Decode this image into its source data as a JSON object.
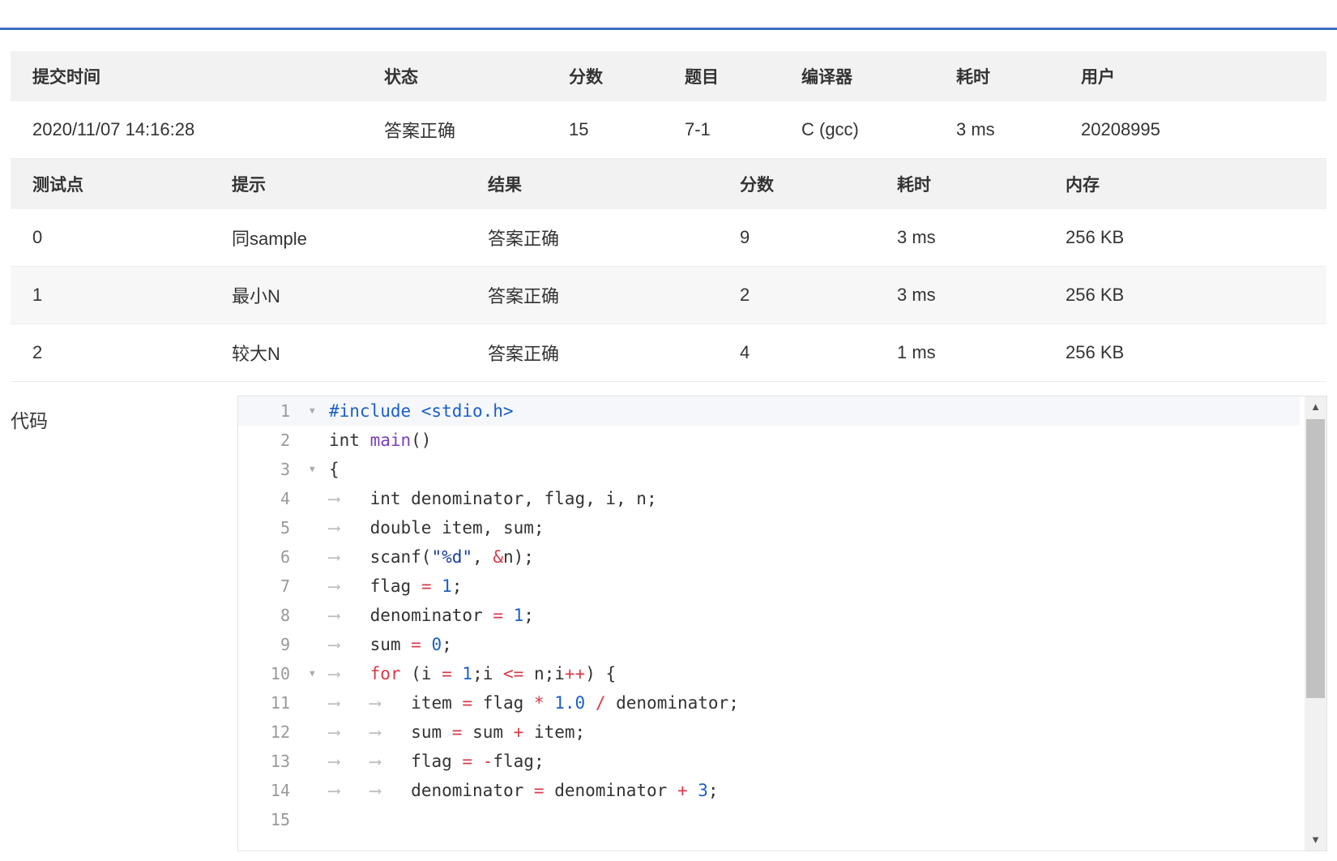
{
  "submission": {
    "headers": [
      "提交时间",
      "状态",
      "分数",
      "题目",
      "编译器",
      "耗时",
      "用户"
    ],
    "row": {
      "time": "2020/11/07 14:16:28",
      "status": "答案正确",
      "score": "15",
      "problem": "7-1",
      "compiler": "C (gcc)",
      "elapsed": "3 ms",
      "user": "20208995"
    }
  },
  "testcases": {
    "headers": [
      "测试点",
      "提示",
      "结果",
      "分数",
      "耗时",
      "内存"
    ],
    "rows": [
      {
        "id": "0",
        "hint": "同sample",
        "result": "答案正确",
        "score": "9",
        "time": "3 ms",
        "memory": "256 KB"
      },
      {
        "id": "1",
        "hint": "最小N",
        "result": "答案正确",
        "score": "2",
        "time": "3 ms",
        "memory": "256 KB"
      },
      {
        "id": "2",
        "hint": "较大N",
        "result": "答案正确",
        "score": "4",
        "time": "1 ms",
        "memory": "256 KB"
      }
    ]
  },
  "code": {
    "label": "代码",
    "line_numbers": [
      "1",
      "2",
      "3",
      "4",
      "5",
      "6",
      "7",
      "8",
      "9",
      "10",
      "11",
      "12",
      "13",
      "14",
      "15"
    ],
    "lines": [
      "#include <stdio.h>",
      "int main()",
      "{",
      "    int denominator, flag, i, n;",
      "    double item, sum;",
      "    scanf(\"%d\", &n);",
      "    flag = 1;",
      "    denominator = 1;",
      "    sum = 0;",
      "    for (i = 1;i <= n;i++) {",
      "        item = flag * 1.0 / denominator;",
      "        sum = sum + item;",
      "        flag = -flag;",
      "        denominator = denominator + 3;",
      ""
    ]
  },
  "colors": {
    "accent": "#3b6cc0",
    "status_ok": "#f33f3f",
    "link": "#2a6ebb"
  }
}
